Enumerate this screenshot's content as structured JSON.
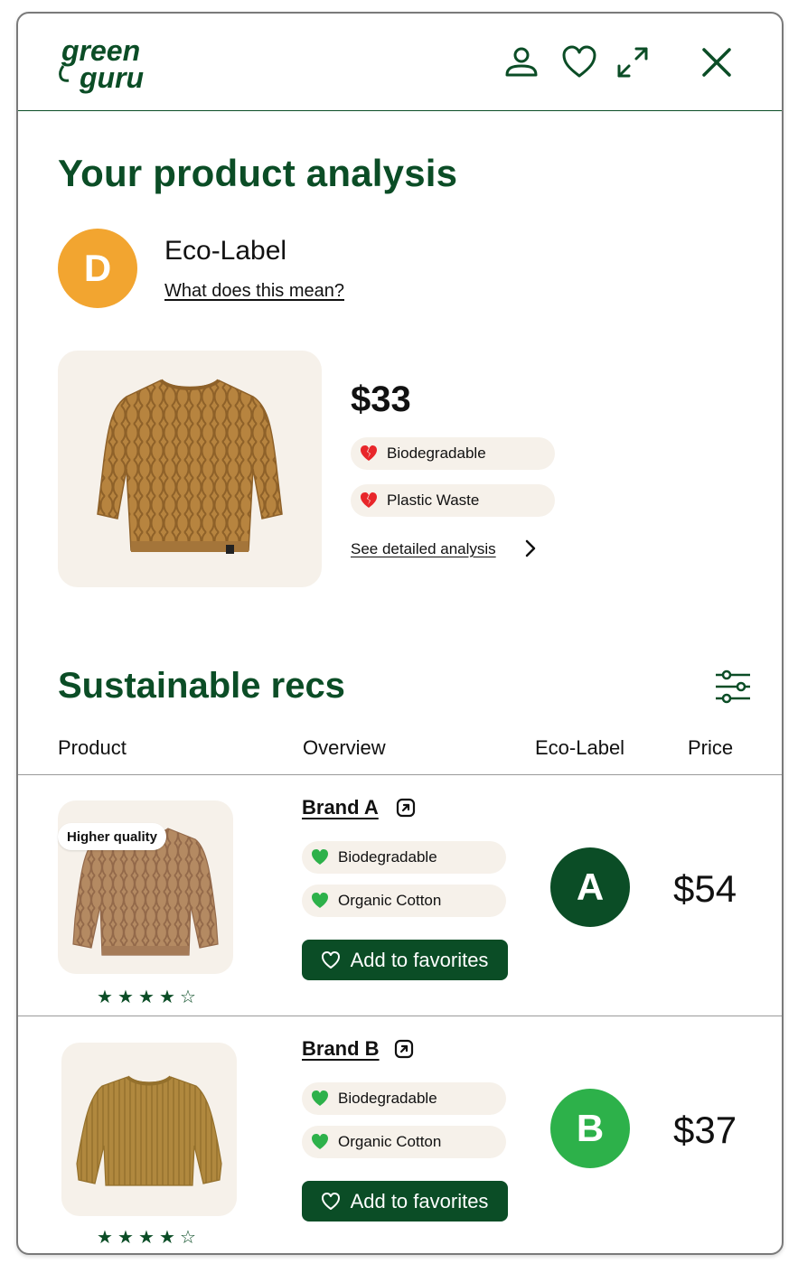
{
  "header": {
    "logo_line1": "green",
    "logo_line2": "guru"
  },
  "analysis": {
    "title": "Your product analysis",
    "grade": "D",
    "grade_color": "#f2a530",
    "eco_label_title": "Eco-Label",
    "eco_label_link": "What does this mean?",
    "price": "$33",
    "attributes": [
      {
        "label": "Biodegradable",
        "icon": "broken-heart-icon"
      },
      {
        "label": "Plastic Waste",
        "icon": "broken-heart-icon"
      }
    ],
    "detail_link": "See detailed analysis"
  },
  "recs": {
    "title": "Sustainable recs",
    "columns": [
      "Product",
      "Overview",
      "Eco-Label",
      "Price"
    ],
    "items": [
      {
        "tag": "Higher quality",
        "rating": 4,
        "brand": "Brand A",
        "attributes": [
          {
            "label": "Biodegradable",
            "icon": "heart-icon"
          },
          {
            "label": "Organic Cotton",
            "icon": "heart-icon"
          }
        ],
        "button": "Add to favorites",
        "grade": "A",
        "grade_color": "#0b4d26",
        "price": "$54"
      },
      {
        "tag": "",
        "rating": 4,
        "brand": "Brand B",
        "attributes": [
          {
            "label": "Biodegradable",
            "icon": "heart-icon"
          },
          {
            "label": "Organic Cotton",
            "icon": "heart-icon"
          }
        ],
        "button": "Add to favorites",
        "grade": "B",
        "grade_color": "#2db14a",
        "price": "$37"
      }
    ]
  },
  "colors": {
    "brand_green": "#0b4d26",
    "pill_bg": "#f6f1ea",
    "heart_green": "#2db14a",
    "broken_heart_red": "#e8262a"
  }
}
